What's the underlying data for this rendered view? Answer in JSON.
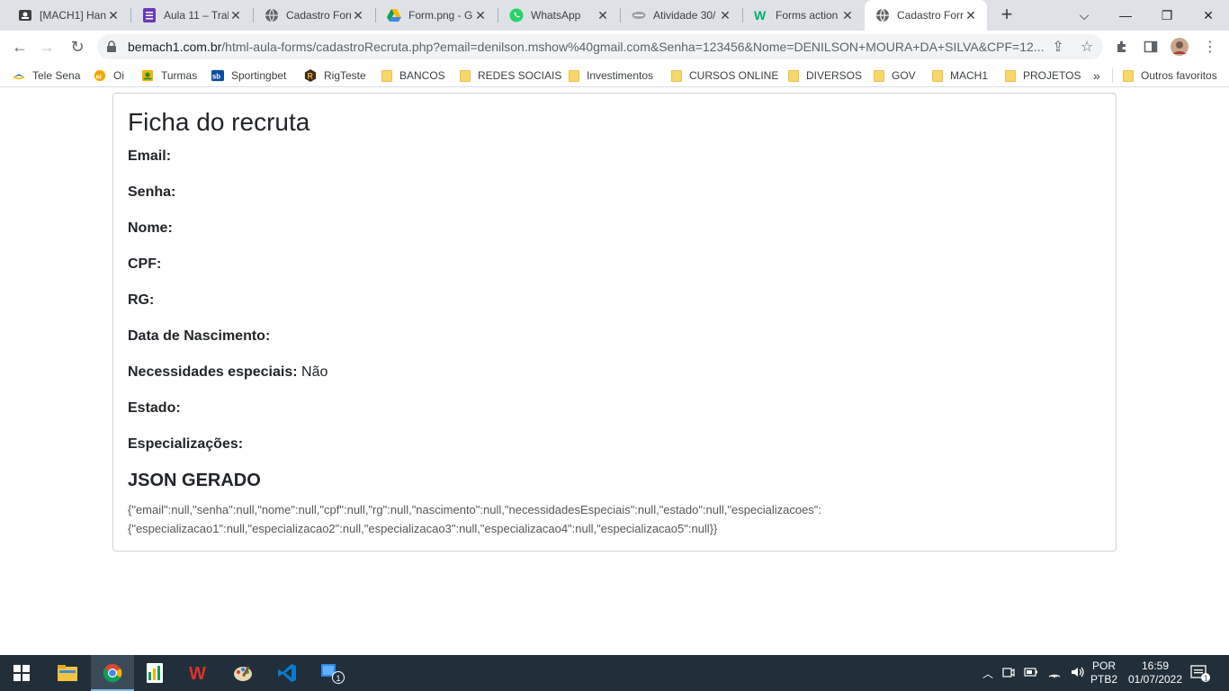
{
  "browser": {
    "tabs": [
      {
        "title": "[MACH1] Han",
        "icon": "profile-card-icon"
      },
      {
        "title": "Aula 11 – Tral",
        "icon": "forms-icon"
      },
      {
        "title": "Cadastro Forr",
        "icon": "globe-icon"
      },
      {
        "title": "Form.png - G",
        "icon": "google-drive-icon"
      },
      {
        "title": "WhatsApp",
        "icon": "whatsapp-icon"
      },
      {
        "title": "Atividade 30/",
        "icon": "generic-site-icon"
      },
      {
        "title": "Forms action",
        "icon": "w-logo-icon"
      },
      {
        "title": "Cadastro Forr",
        "icon": "globe-icon",
        "active": true
      }
    ],
    "url_host": "bemach1.com.br",
    "url_path": "/html-aula-forms/cadastroRecruta.php?email=denilson.mshow%40gmail.com&Senha=123456&Nome=DENILSON+MOURA+DA+SILVA&CPF=12...",
    "bookmarks": [
      {
        "label": "Tele Sena",
        "type": "link"
      },
      {
        "label": "Oi",
        "type": "link"
      },
      {
        "label": "Turmas",
        "type": "link"
      },
      {
        "label": "Sportingbet",
        "type": "link"
      },
      {
        "label": "RigTeste",
        "type": "link"
      },
      {
        "label": "BANCOS",
        "type": "folder"
      },
      {
        "label": "REDES SOCIAIS",
        "type": "folder"
      },
      {
        "label": "Investimentos",
        "type": "folder"
      },
      {
        "label": "CURSOS ONLINE",
        "type": "folder"
      },
      {
        "label": "DIVERSOS",
        "type": "folder"
      },
      {
        "label": "GOV",
        "type": "folder"
      },
      {
        "label": "MACH1",
        "type": "folder"
      },
      {
        "label": "PROJETOS",
        "type": "folder"
      }
    ],
    "bookmarks_more": "»",
    "other_bookmarks": "Outros favoritos"
  },
  "page": {
    "title": "Ficha do recruta",
    "fields": [
      {
        "label": "Email:",
        "value": ""
      },
      {
        "label": "Senha:",
        "value": ""
      },
      {
        "label": "Nome:",
        "value": ""
      },
      {
        "label": "CPF:",
        "value": ""
      },
      {
        "label": "RG:",
        "value": ""
      },
      {
        "label": "Data de Nascimento:",
        "value": ""
      },
      {
        "label": "Necessidades especiais:",
        "value": "Não"
      },
      {
        "label": "Estado:",
        "value": ""
      },
      {
        "label": "Especializações:",
        "value": ""
      }
    ],
    "json_title": "JSON GERADO",
    "json_line1": "{\"email\":null,\"senha\":null,\"nome\":null,\"cpf\":null,\"rg\":null,\"nascimento\":null,\"necessidadesEspeciais\":null,\"estado\":null,\"especializacoes\":",
    "json_line2": "{\"especializacao1\":null,\"especializacao2\":null,\"especializacao3\":null,\"especializacao4\":null,\"especializacao5\":null}}"
  },
  "taskbar": {
    "apps": [
      "windows-start-icon",
      "file-explorer-icon",
      "chrome-icon",
      "sheets-icon",
      "wps-icon",
      "paint-icon",
      "vscode-icon",
      "notes-app-icon"
    ],
    "badge": "1",
    "lang_line1": "POR",
    "lang_line2": "PTB2",
    "time": "16:59",
    "date": "01/07/2022",
    "notification_count": "1"
  }
}
